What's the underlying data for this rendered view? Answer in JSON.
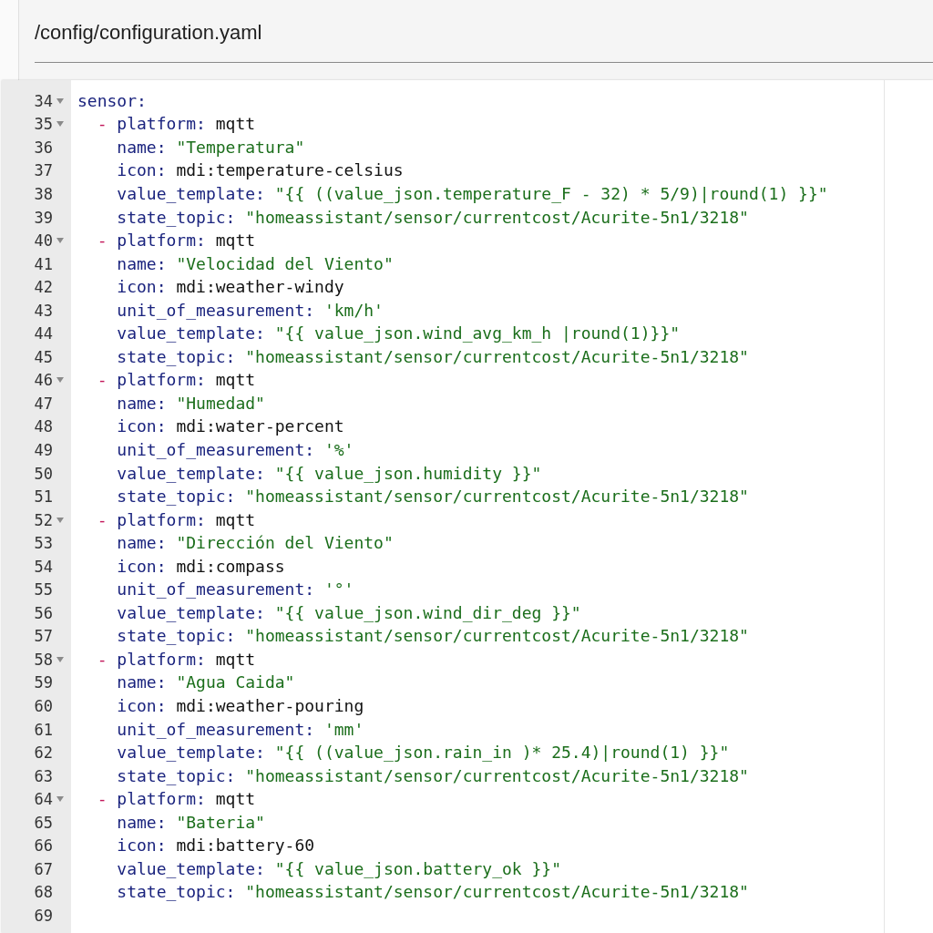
{
  "header": {
    "title": "/config/configuration.yaml"
  },
  "editor": {
    "lines": [
      {
        "number": "34",
        "foldable": true,
        "tokens": [
          {
            "kind": "key",
            "text": "sensor:"
          }
        ]
      },
      {
        "number": "35",
        "foldable": true,
        "tokens": [
          {
            "kind": "dash",
            "text": "  -"
          },
          {
            "kind": "key",
            "text": " platform:"
          },
          {
            "kind": "plain",
            "text": " mqtt"
          }
        ]
      },
      {
        "number": "36",
        "foldable": false,
        "tokens": [
          {
            "kind": "key",
            "text": "    name:"
          },
          {
            "kind": "string",
            "text": " \"Temperatura\""
          }
        ]
      },
      {
        "number": "37",
        "foldable": false,
        "tokens": [
          {
            "kind": "key",
            "text": "    icon:"
          },
          {
            "kind": "plain",
            "text": " mdi:temperature-celsius"
          }
        ]
      },
      {
        "number": "38",
        "foldable": false,
        "tokens": [
          {
            "kind": "key",
            "text": "    value_template:"
          },
          {
            "kind": "string",
            "text": " \"{{ ((value_json.temperature_F - 32) * 5/9)|round(1) }}\""
          }
        ]
      },
      {
        "number": "39",
        "foldable": false,
        "tokens": [
          {
            "kind": "key",
            "text": "    state_topic:"
          },
          {
            "kind": "string",
            "text": " \"homeassistant/sensor/currentcost/Acurite-5n1/3218\""
          }
        ]
      },
      {
        "number": "40",
        "foldable": true,
        "tokens": [
          {
            "kind": "dash",
            "text": "  -"
          },
          {
            "kind": "key",
            "text": " platform:"
          },
          {
            "kind": "plain",
            "text": " mqtt"
          }
        ]
      },
      {
        "number": "41",
        "foldable": false,
        "tokens": [
          {
            "kind": "key",
            "text": "    name:"
          },
          {
            "kind": "string",
            "text": " \"Velocidad del Viento\""
          }
        ]
      },
      {
        "number": "42",
        "foldable": false,
        "tokens": [
          {
            "kind": "key",
            "text": "    icon:"
          },
          {
            "kind": "plain",
            "text": " mdi:weather-windy"
          }
        ]
      },
      {
        "number": "43",
        "foldable": false,
        "tokens": [
          {
            "kind": "key",
            "text": "    unit_of_measurement:"
          },
          {
            "kind": "string",
            "text": " 'km/h'"
          }
        ]
      },
      {
        "number": "44",
        "foldable": false,
        "tokens": [
          {
            "kind": "key",
            "text": "    value_template:"
          },
          {
            "kind": "string",
            "text": " \"{{ value_json.wind_avg_km_h |round(1)}}\""
          }
        ]
      },
      {
        "number": "45",
        "foldable": false,
        "tokens": [
          {
            "kind": "key",
            "text": "    state_topic:"
          },
          {
            "kind": "string",
            "text": " \"homeassistant/sensor/currentcost/Acurite-5n1/3218\""
          }
        ]
      },
      {
        "number": "46",
        "foldable": true,
        "tokens": [
          {
            "kind": "dash",
            "text": "  -"
          },
          {
            "kind": "key",
            "text": " platform:"
          },
          {
            "kind": "plain",
            "text": " mqtt"
          }
        ]
      },
      {
        "number": "47",
        "foldable": false,
        "tokens": [
          {
            "kind": "key",
            "text": "    name:"
          },
          {
            "kind": "string",
            "text": " \"Humedad\""
          }
        ]
      },
      {
        "number": "48",
        "foldable": false,
        "tokens": [
          {
            "kind": "key",
            "text": "    icon:"
          },
          {
            "kind": "plain",
            "text": " mdi:water-percent"
          }
        ]
      },
      {
        "number": "49",
        "foldable": false,
        "tokens": [
          {
            "kind": "key",
            "text": "    unit_of_measurement:"
          },
          {
            "kind": "string",
            "text": " '%'"
          }
        ]
      },
      {
        "number": "50",
        "foldable": false,
        "tokens": [
          {
            "kind": "key",
            "text": "    value_template:"
          },
          {
            "kind": "string",
            "text": " \"{{ value_json.humidity }}\""
          }
        ]
      },
      {
        "number": "51",
        "foldable": false,
        "tokens": [
          {
            "kind": "key",
            "text": "    state_topic:"
          },
          {
            "kind": "string",
            "text": " \"homeassistant/sensor/currentcost/Acurite-5n1/3218\""
          }
        ]
      },
      {
        "number": "52",
        "foldable": true,
        "tokens": [
          {
            "kind": "dash",
            "text": "  -"
          },
          {
            "kind": "key",
            "text": " platform:"
          },
          {
            "kind": "plain",
            "text": " mqtt"
          }
        ]
      },
      {
        "number": "53",
        "foldable": false,
        "tokens": [
          {
            "kind": "key",
            "text": "    name:"
          },
          {
            "kind": "string",
            "text": " \"Dirección del Viento\""
          }
        ]
      },
      {
        "number": "54",
        "foldable": false,
        "tokens": [
          {
            "kind": "key",
            "text": "    icon:"
          },
          {
            "kind": "plain",
            "text": " mdi:compass"
          }
        ]
      },
      {
        "number": "55",
        "foldable": false,
        "tokens": [
          {
            "kind": "key",
            "text": "    unit_of_measurement:"
          },
          {
            "kind": "string",
            "text": " '°'"
          }
        ]
      },
      {
        "number": "56",
        "foldable": false,
        "tokens": [
          {
            "kind": "key",
            "text": "    value_template:"
          },
          {
            "kind": "string",
            "text": " \"{{ value_json.wind_dir_deg }}\""
          }
        ]
      },
      {
        "number": "57",
        "foldable": false,
        "tokens": [
          {
            "kind": "key",
            "text": "    state_topic:"
          },
          {
            "kind": "string",
            "text": " \"homeassistant/sensor/currentcost/Acurite-5n1/3218\""
          }
        ]
      },
      {
        "number": "58",
        "foldable": true,
        "tokens": [
          {
            "kind": "dash",
            "text": "  -"
          },
          {
            "kind": "key",
            "text": " platform:"
          },
          {
            "kind": "plain",
            "text": " mqtt"
          }
        ]
      },
      {
        "number": "59",
        "foldable": false,
        "tokens": [
          {
            "kind": "key",
            "text": "    name:"
          },
          {
            "kind": "string",
            "text": " \"Agua Caida\""
          }
        ]
      },
      {
        "number": "60",
        "foldable": false,
        "tokens": [
          {
            "kind": "key",
            "text": "    icon:"
          },
          {
            "kind": "plain",
            "text": " mdi:weather-pouring"
          }
        ]
      },
      {
        "number": "61",
        "foldable": false,
        "tokens": [
          {
            "kind": "key",
            "text": "    unit_of_measurement:"
          },
          {
            "kind": "string",
            "text": " 'mm'"
          }
        ]
      },
      {
        "number": "62",
        "foldable": false,
        "tokens": [
          {
            "kind": "key",
            "text": "    value_template:"
          },
          {
            "kind": "string",
            "text": " \"{{ ((value_json.rain_in )* 25.4)|round(1) }}\""
          }
        ]
      },
      {
        "number": "63",
        "foldable": false,
        "tokens": [
          {
            "kind": "key",
            "text": "    state_topic:"
          },
          {
            "kind": "string",
            "text": " \"homeassistant/sensor/currentcost/Acurite-5n1/3218\""
          }
        ]
      },
      {
        "number": "64",
        "foldable": true,
        "tokens": [
          {
            "kind": "dash",
            "text": "  -"
          },
          {
            "kind": "key",
            "text": " platform:"
          },
          {
            "kind": "plain",
            "text": " mqtt"
          }
        ]
      },
      {
        "number": "65",
        "foldable": false,
        "tokens": [
          {
            "kind": "key",
            "text": "    name:"
          },
          {
            "kind": "string",
            "text": " \"Bateria\""
          }
        ]
      },
      {
        "number": "66",
        "foldable": false,
        "tokens": [
          {
            "kind": "key",
            "text": "    icon:"
          },
          {
            "kind": "plain",
            "text": " mdi:battery-60"
          }
        ]
      },
      {
        "number": "67",
        "foldable": false,
        "tokens": [
          {
            "kind": "key",
            "text": "    value_template:"
          },
          {
            "kind": "string",
            "text": " \"{{ value_json.battery_ok }}\""
          }
        ]
      },
      {
        "number": "68",
        "foldable": false,
        "tokens": [
          {
            "kind": "key",
            "text": "    state_topic:"
          },
          {
            "kind": "string",
            "text": " \"homeassistant/sensor/currentcost/Acurite-5n1/3218\""
          }
        ]
      },
      {
        "number": "69",
        "foldable": false
      }
    ]
  }
}
